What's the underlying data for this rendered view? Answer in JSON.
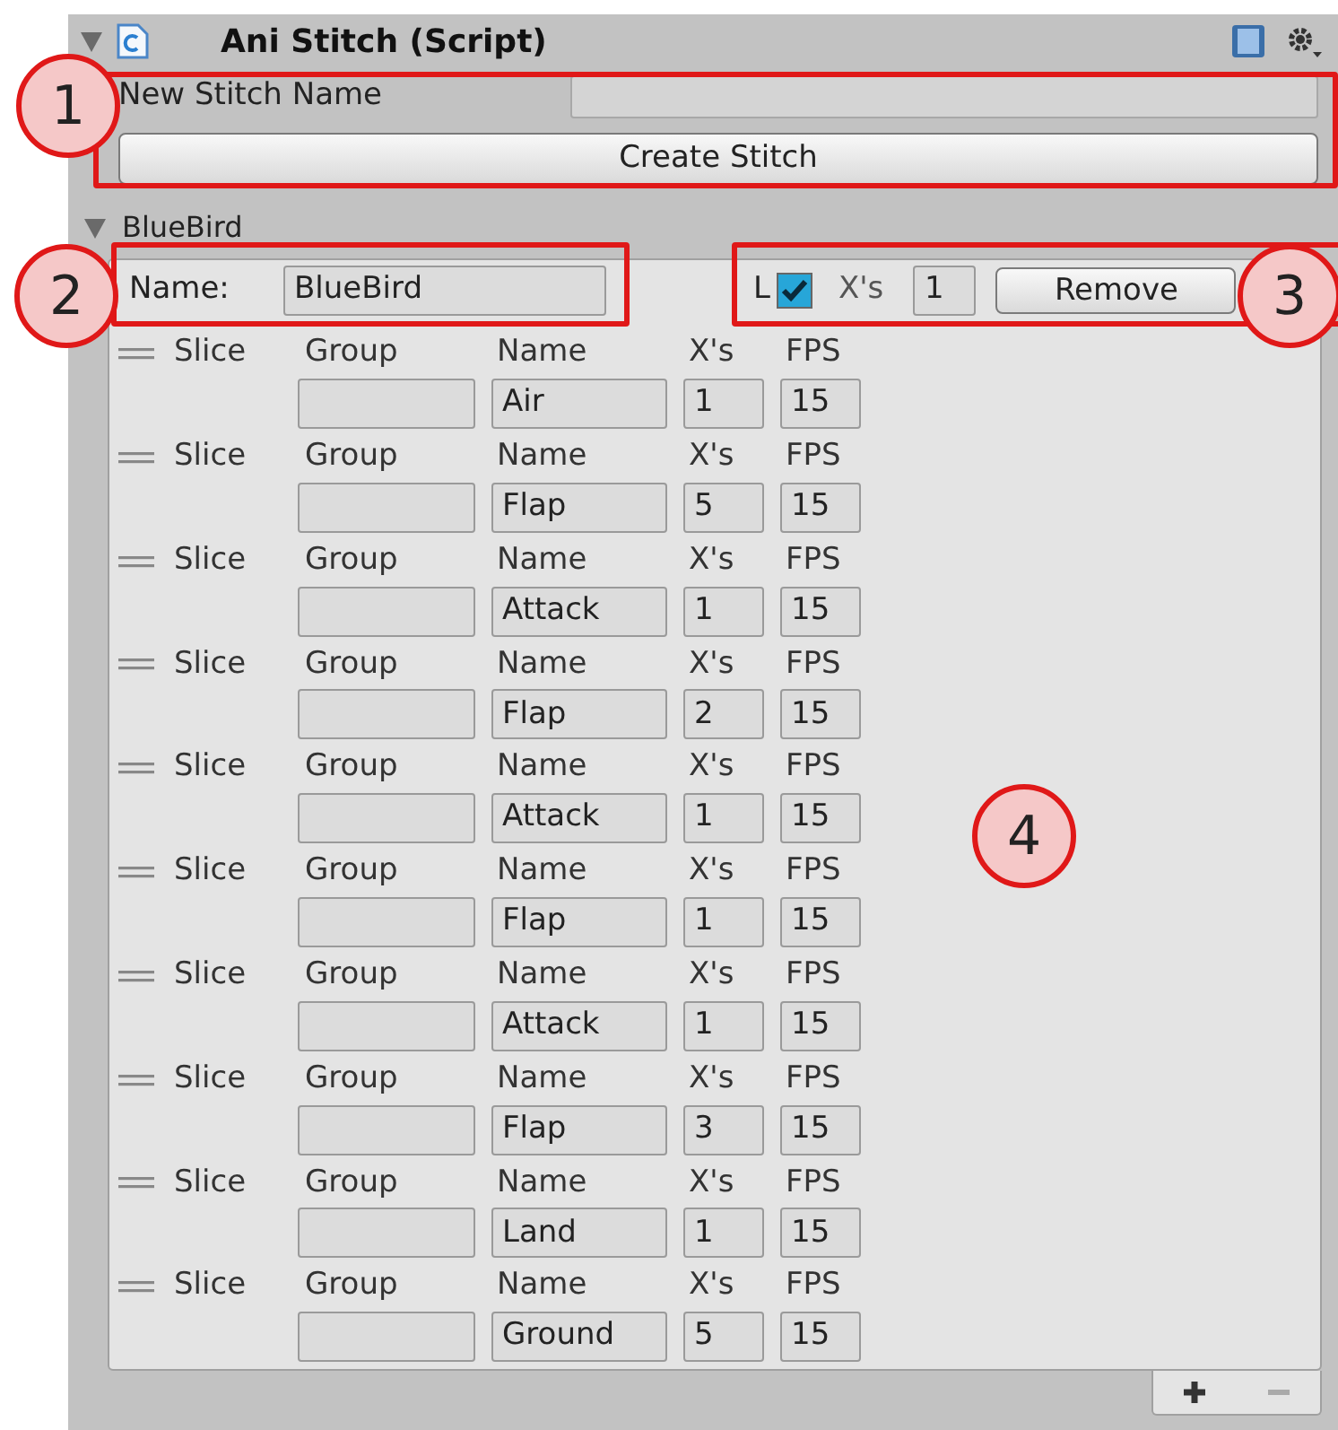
{
  "component": {
    "title": "Ani Stitch (Script)",
    "expanded": true
  },
  "new_stitch": {
    "label": "New Stitch Name",
    "button": "Create Stitch"
  },
  "stitch": {
    "foldout": "BlueBird",
    "expanded": true,
    "name_label": "Name:",
    "name_value": "BlueBird",
    "loop_label": "L",
    "loop_checked": true,
    "xs_label": "X's",
    "xs_value": "1",
    "remove_button": "Remove",
    "slices": [
      {
        "handle": "Slice",
        "group_label": "Group",
        "name_label": "Name",
        "xs_label": "X's",
        "fps_label": "FPS",
        "name": "Air",
        "xs": "1",
        "fps": "15"
      },
      {
        "handle": "Slice",
        "group_label": "Group",
        "name_label": "Name",
        "xs_label": "X's",
        "fps_label": "FPS",
        "name": "Flap",
        "xs": "5",
        "fps": "15"
      },
      {
        "handle": "Slice",
        "group_label": "Group",
        "name_label": "Name",
        "xs_label": "X's",
        "fps_label": "FPS",
        "name": "Attack",
        "xs": "1",
        "fps": "15"
      },
      {
        "handle": "Slice",
        "group_label": "Group",
        "name_label": "Name",
        "xs_label": "X's",
        "fps_label": "FPS",
        "name": "Flap",
        "xs": "2",
        "fps": "15"
      },
      {
        "handle": "Slice",
        "group_label": "Group",
        "name_label": "Name",
        "xs_label": "X's",
        "fps_label": "FPS",
        "name": "Attack",
        "xs": "1",
        "fps": "15"
      },
      {
        "handle": "Slice",
        "group_label": "Group",
        "name_label": "Name",
        "xs_label": "X's",
        "fps_label": "FPS",
        "name": "Flap",
        "xs": "1",
        "fps": "15"
      },
      {
        "handle": "Slice",
        "group_label": "Group",
        "name_label": "Name",
        "xs_label": "X's",
        "fps_label": "FPS",
        "name": "Attack",
        "xs": "1",
        "fps": "15"
      },
      {
        "handle": "Slice",
        "group_label": "Group",
        "name_label": "Name",
        "xs_label": "X's",
        "fps_label": "FPS",
        "name": "Flap",
        "xs": "3",
        "fps": "15"
      },
      {
        "handle": "Slice",
        "group_label": "Group",
        "name_label": "Name",
        "xs_label": "X's",
        "fps_label": "FPS",
        "name": "Land",
        "xs": "1",
        "fps": "15"
      },
      {
        "handle": "Slice",
        "group_label": "Group",
        "name_label": "Name",
        "xs_label": "X's",
        "fps_label": "FPS",
        "name": "Ground",
        "xs": "5",
        "fps": "15"
      }
    ]
  },
  "annotations": [
    "1",
    "2",
    "3",
    "4"
  ]
}
